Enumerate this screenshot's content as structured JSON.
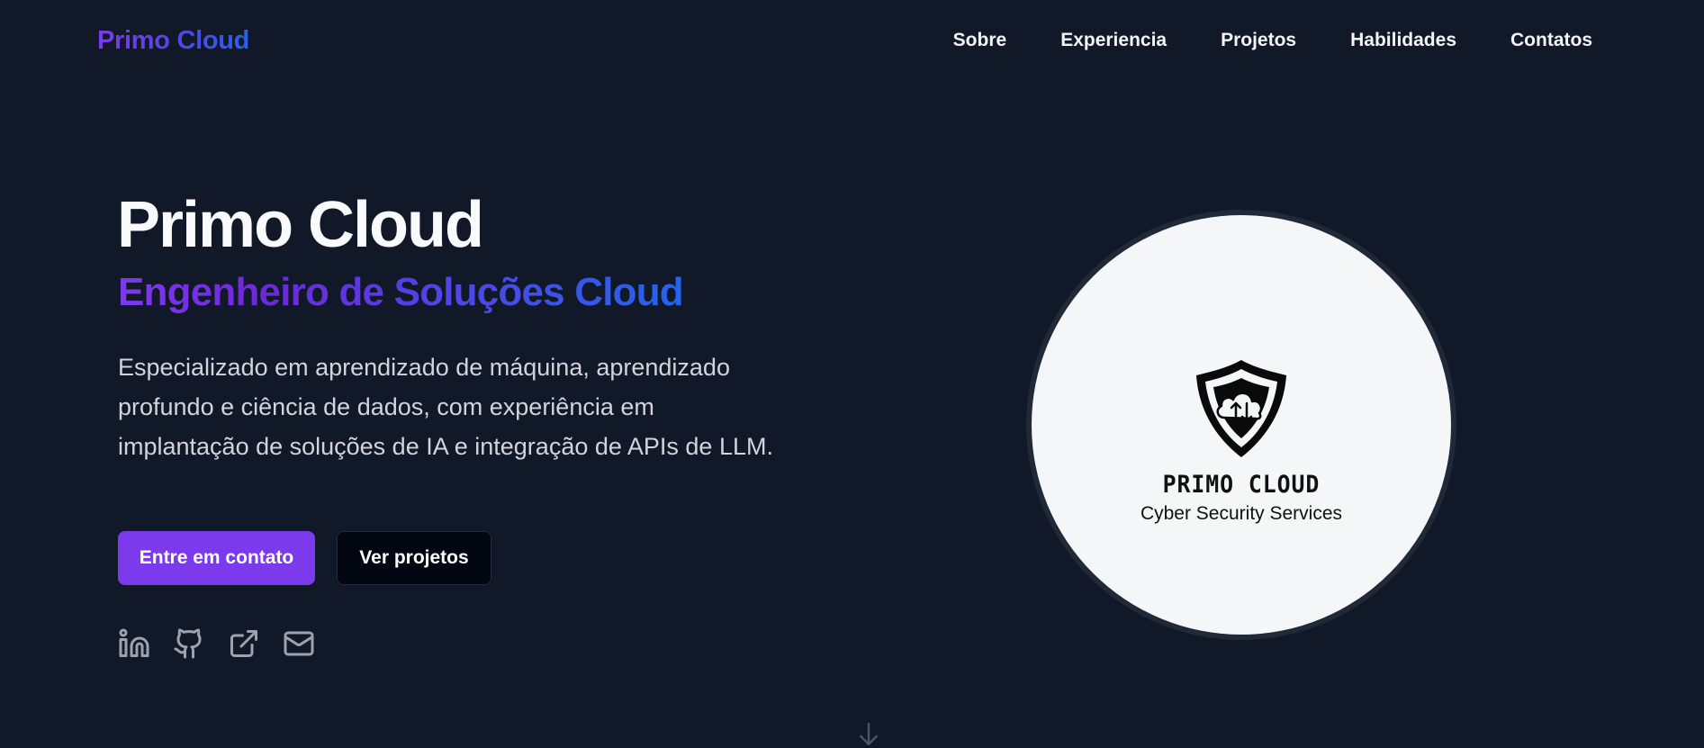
{
  "header": {
    "brand": "Primo Cloud",
    "nav": [
      {
        "label": "Sobre"
      },
      {
        "label": "Experiencia"
      },
      {
        "label": "Projetos"
      },
      {
        "label": "Habilidades"
      },
      {
        "label": "Contatos"
      }
    ]
  },
  "hero": {
    "title": "Primo Cloud",
    "subtitle": "Engenheiro de Soluções Cloud",
    "description": "Especializado em aprendizado de máquina, aprendizado profundo e ciência de dados, com experiência em implantação de soluções de IA e integração de APIs de LLM.",
    "primary_button": "Entre em contato",
    "secondary_button": "Ver projetos",
    "social_icons": [
      "linkedin-icon",
      "github-icon",
      "external-link-icon",
      "mail-icon"
    ]
  },
  "logo": {
    "name": "PRIMO CLOUD",
    "tagline": "Cyber Security Services",
    "icon": "shield-cloud-icon"
  },
  "scroll_icon": "arrow-down-icon",
  "colors": {
    "background": "#111827",
    "accent_purple": "#7c3aed",
    "accent_blue": "#2563eb",
    "text": "#f3f4f6",
    "muted": "#9ca3af"
  }
}
